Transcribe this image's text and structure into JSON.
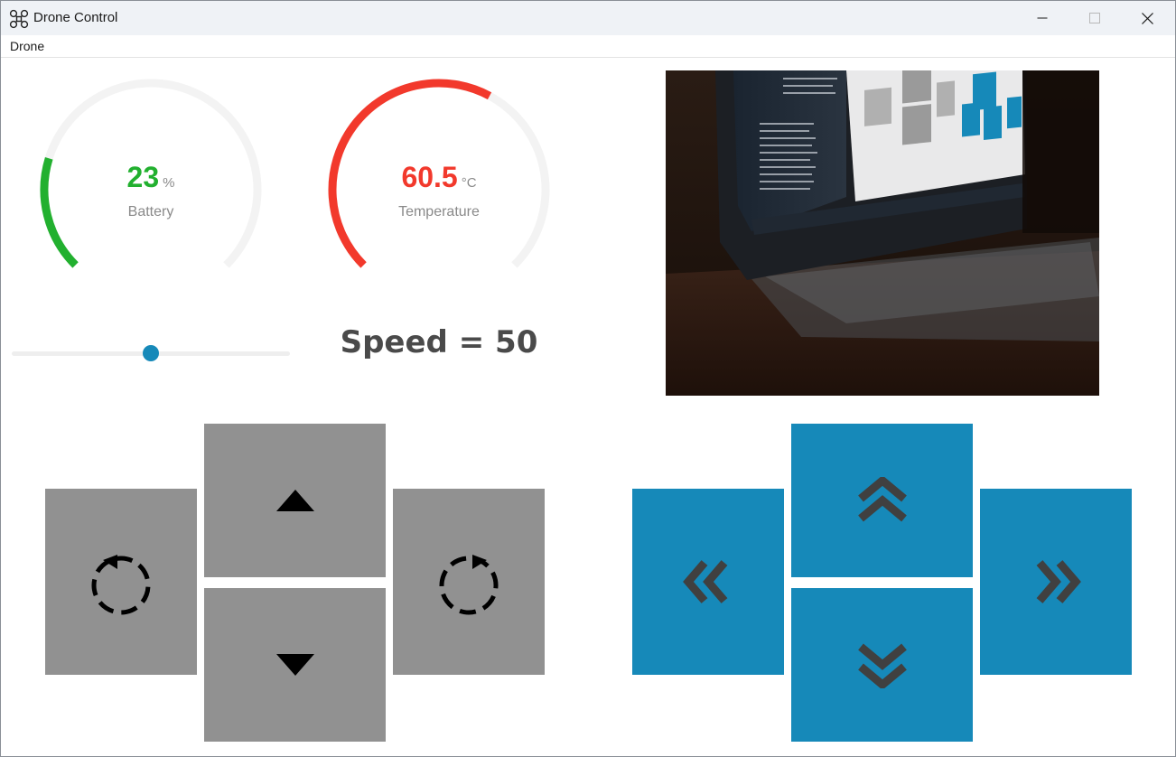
{
  "window": {
    "title": "Drone Control",
    "icon": "drone-icon"
  },
  "menu": {
    "items": [
      "Drone"
    ]
  },
  "battery": {
    "value": "23",
    "unit": "%",
    "label": "Battery",
    "percent": 23,
    "color": "#22b02f"
  },
  "temperature": {
    "value": "60.5",
    "unit": "°C",
    "label": "Temperature",
    "percent": 60.5,
    "color": "#f2392c"
  },
  "speed": {
    "text": "Speed = 50",
    "slider_value": 50,
    "slider_min": 0,
    "slider_max": 100
  },
  "camera": {
    "description_icon": "camera-feed-image"
  },
  "controls": {
    "rotate_left": "rotate-left-icon",
    "up": "arrow-up-icon",
    "down": "arrow-down-icon",
    "rotate_right": "rotate-right-icon",
    "forward": "double-chevron-up-icon",
    "backward": "double-chevron-down-icon",
    "left": "double-chevron-left-icon",
    "right": "double-chevron-right-icon"
  },
  "colors": {
    "gray_button": "#919191",
    "blue_button": "#1689b9",
    "gauge_track": "#f3f3f3"
  }
}
